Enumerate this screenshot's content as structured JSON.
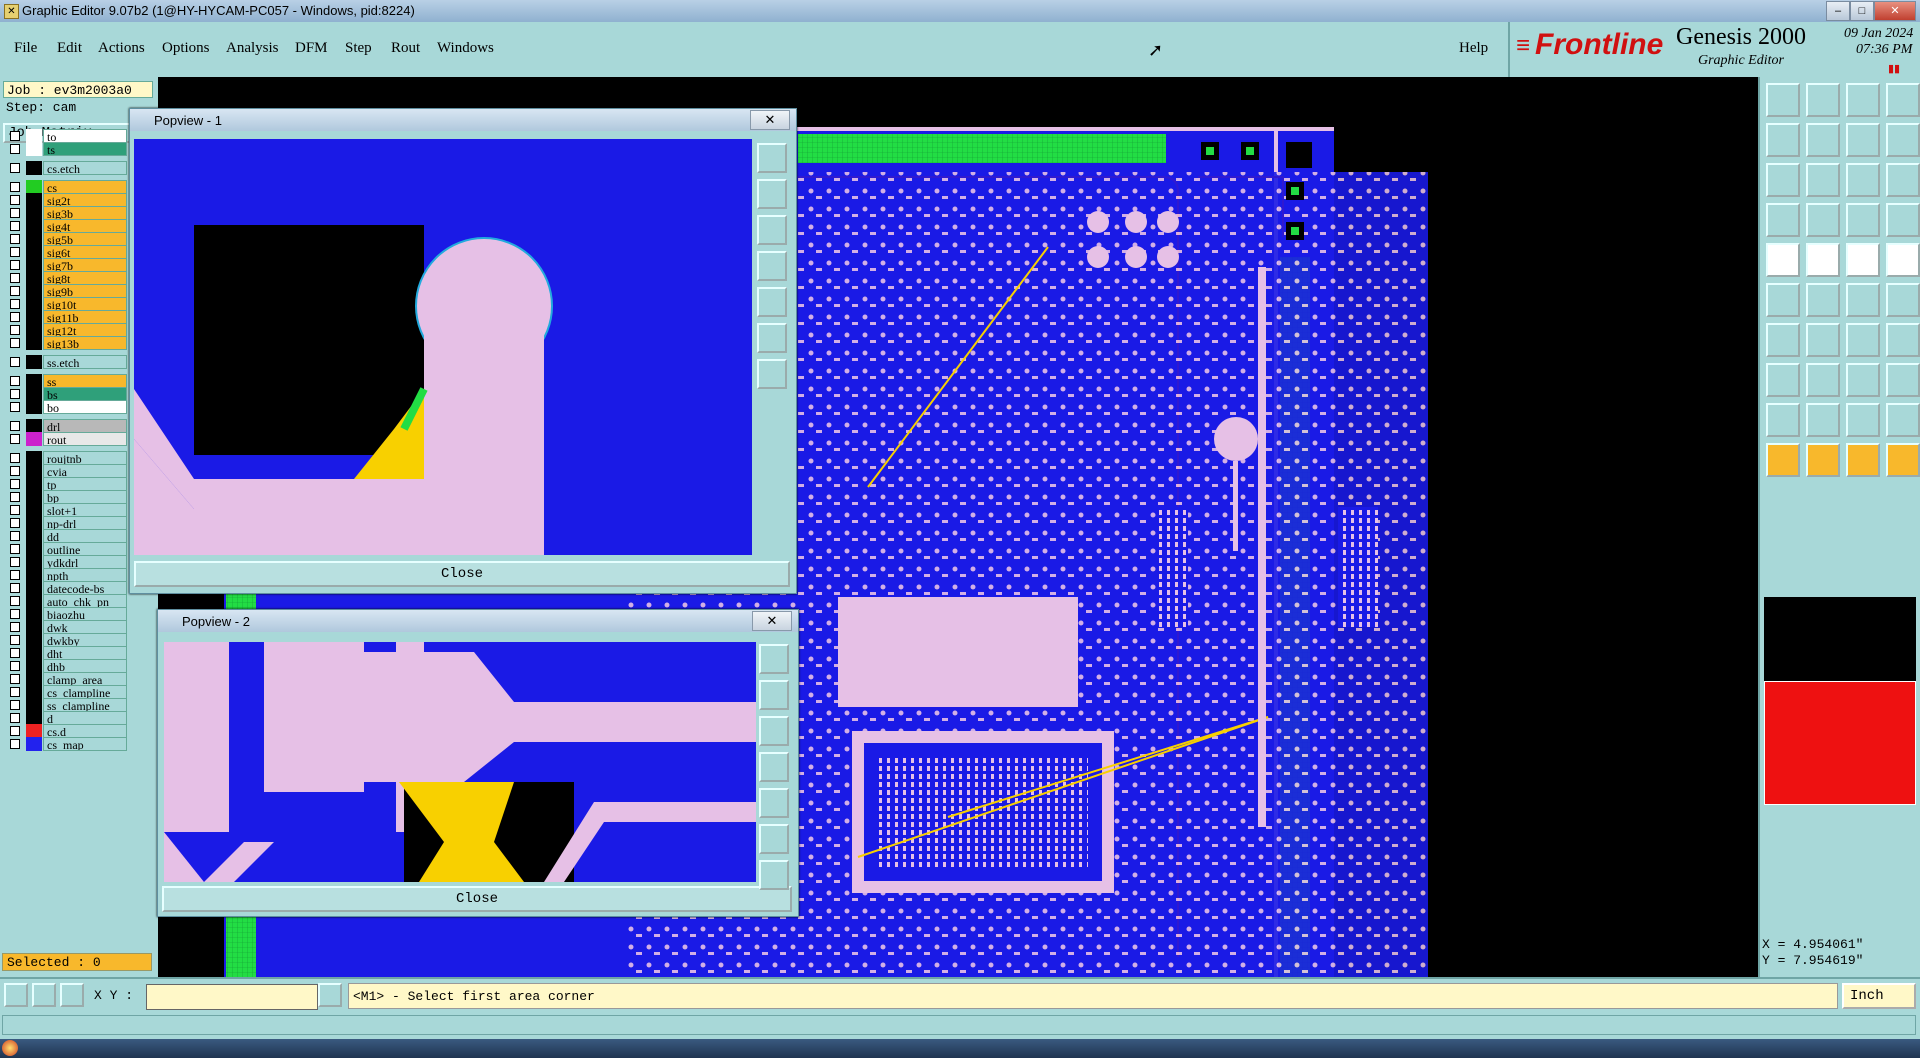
{
  "window": {
    "title": "Graphic Editor 9.07b2 (1@HY-HYCAM-PC057 - Windows, pid:8224)"
  },
  "menu": {
    "items": [
      "File",
      "Edit",
      "Actions",
      "Options",
      "Analysis",
      "DFM",
      "Step",
      "Rout",
      "Windows"
    ],
    "help": "Help"
  },
  "brand": {
    "logo": "Frontline",
    "product": "Genesis 2000",
    "subtitle": "Graphic Editor",
    "date": "09 Jan 2024",
    "time": "07:36 PM"
  },
  "job": {
    "job_label": "Job : ev3m2003a0",
    "step_label": "Step: cam",
    "matrix_label": "Job Matrix .."
  },
  "layers": [
    {
      "name": "to",
      "swatch": "#ffffff",
      "bg": "#ffffff"
    },
    {
      "name": "ts",
      "swatch": "#ffffff",
      "bg": "#2fa07a"
    },
    {
      "name": "cs.etch",
      "swatch": "#000000",
      "bg": "#a8d8d8"
    },
    {
      "name": "cs",
      "swatch": "#22cc22",
      "bg": "#f8b82c"
    },
    {
      "name": "sig2t",
      "swatch": "#000000",
      "bg": "#f8b82c"
    },
    {
      "name": "sig3b",
      "swatch": "#000000",
      "bg": "#f8b82c"
    },
    {
      "name": "sig4t",
      "swatch": "#000000",
      "bg": "#f8b82c"
    },
    {
      "name": "sig5b",
      "swatch": "#000000",
      "bg": "#f8b82c"
    },
    {
      "name": "sig6t",
      "swatch": "#000000",
      "bg": "#f8b82c"
    },
    {
      "name": "sig7b",
      "swatch": "#000000",
      "bg": "#f8b82c"
    },
    {
      "name": "sig8t",
      "swatch": "#000000",
      "bg": "#f8b82c"
    },
    {
      "name": "sig9b",
      "swatch": "#000000",
      "bg": "#f8b82c"
    },
    {
      "name": "sig10t",
      "swatch": "#000000",
      "bg": "#f8b82c"
    },
    {
      "name": "sig11b",
      "swatch": "#000000",
      "bg": "#f8b82c"
    },
    {
      "name": "sig12t",
      "swatch": "#000000",
      "bg": "#f8b82c"
    },
    {
      "name": "sig13b",
      "swatch": "#000000",
      "bg": "#f8b82c"
    },
    {
      "name": "ss.etch",
      "swatch": "#000000",
      "bg": "#a8d8d8"
    },
    {
      "name": "ss",
      "swatch": "#000000",
      "bg": "#f8b82c"
    },
    {
      "name": "bs",
      "swatch": "#000000",
      "bg": "#2fa07a"
    },
    {
      "name": "bo",
      "swatch": "#000000",
      "bg": "#ffffff"
    },
    {
      "name": "drl",
      "swatch": "#000000",
      "bg": "#b8b8b8"
    },
    {
      "name": "rout",
      "swatch": "#cc22cc",
      "bg": "#e8e8e8"
    },
    {
      "name": "roujtnb",
      "swatch": "#000000",
      "bg": "#a8d8d8"
    },
    {
      "name": "cvia",
      "swatch": "#000000",
      "bg": "#a8d8d8"
    },
    {
      "name": "tp",
      "swatch": "#000000",
      "bg": "#a8d8d8"
    },
    {
      "name": "bp",
      "swatch": "#000000",
      "bg": "#a8d8d8"
    },
    {
      "name": "slot+1",
      "swatch": "#000000",
      "bg": "#a8d8d8"
    },
    {
      "name": "np-drl",
      "swatch": "#000000",
      "bg": "#a8d8d8"
    },
    {
      "name": "dd",
      "swatch": "#000000",
      "bg": "#a8d8d8"
    },
    {
      "name": "outline",
      "swatch": "#000000",
      "bg": "#a8d8d8"
    },
    {
      "name": "ydkdrl",
      "swatch": "#000000",
      "bg": "#a8d8d8"
    },
    {
      "name": "npth",
      "swatch": "#000000",
      "bg": "#a8d8d8"
    },
    {
      "name": "datecode-bs",
      "swatch": "#000000",
      "bg": "#a8d8d8"
    },
    {
      "name": "auto_chk_pn",
      "swatch": "#000000",
      "bg": "#a8d8d8"
    },
    {
      "name": "biaozhu",
      "swatch": "#000000",
      "bg": "#a8d8d8"
    },
    {
      "name": "dwk",
      "swatch": "#000000",
      "bg": "#a8d8d8"
    },
    {
      "name": "dwkby",
      "swatch": "#000000",
      "bg": "#a8d8d8"
    },
    {
      "name": "dht",
      "swatch": "#000000",
      "bg": "#a8d8d8"
    },
    {
      "name": "dhb",
      "swatch": "#000000",
      "bg": "#a8d8d8"
    },
    {
      "name": "clamp_area",
      "swatch": "#000000",
      "bg": "#a8d8d8"
    },
    {
      "name": "cs_clampline",
      "swatch": "#000000",
      "bg": "#a8d8d8"
    },
    {
      "name": "ss_clampline",
      "swatch": "#000000",
      "bg": "#a8d8d8"
    },
    {
      "name": "d",
      "swatch": "#000000",
      "bg": "#a8d8d8"
    },
    {
      "name": "cs.d",
      "swatch": "#ee2222",
      "bg": "#a8d8d8"
    },
    {
      "name": "cs_map",
      "swatch": "#2222ee",
      "bg": "#a8d8d8"
    }
  ],
  "status": {
    "selected": "Selected : 0",
    "xy_label": "X Y :",
    "xy_value": "",
    "prompt": "<M1> - Select first area corner",
    "units": "Inch"
  },
  "coords": {
    "x": "X = 4.954061\"",
    "y": "Y = 7.954619\""
  },
  "popups": [
    {
      "title": "Popview - 1",
      "close_label": "Close",
      "x_label": "✕"
    },
    {
      "title": "Popview - 2",
      "close_label": "Close",
      "x_label": "✕"
    }
  ],
  "colors": {
    "bg": "#a8d8d8",
    "board_blue": "#1a1ae6",
    "pad_pink": "#e6c0e6",
    "copper_green": "#22dd44",
    "highlight_yellow": "#f8d000",
    "accent_red": "#ee1111",
    "orange": "#f8b82c"
  }
}
